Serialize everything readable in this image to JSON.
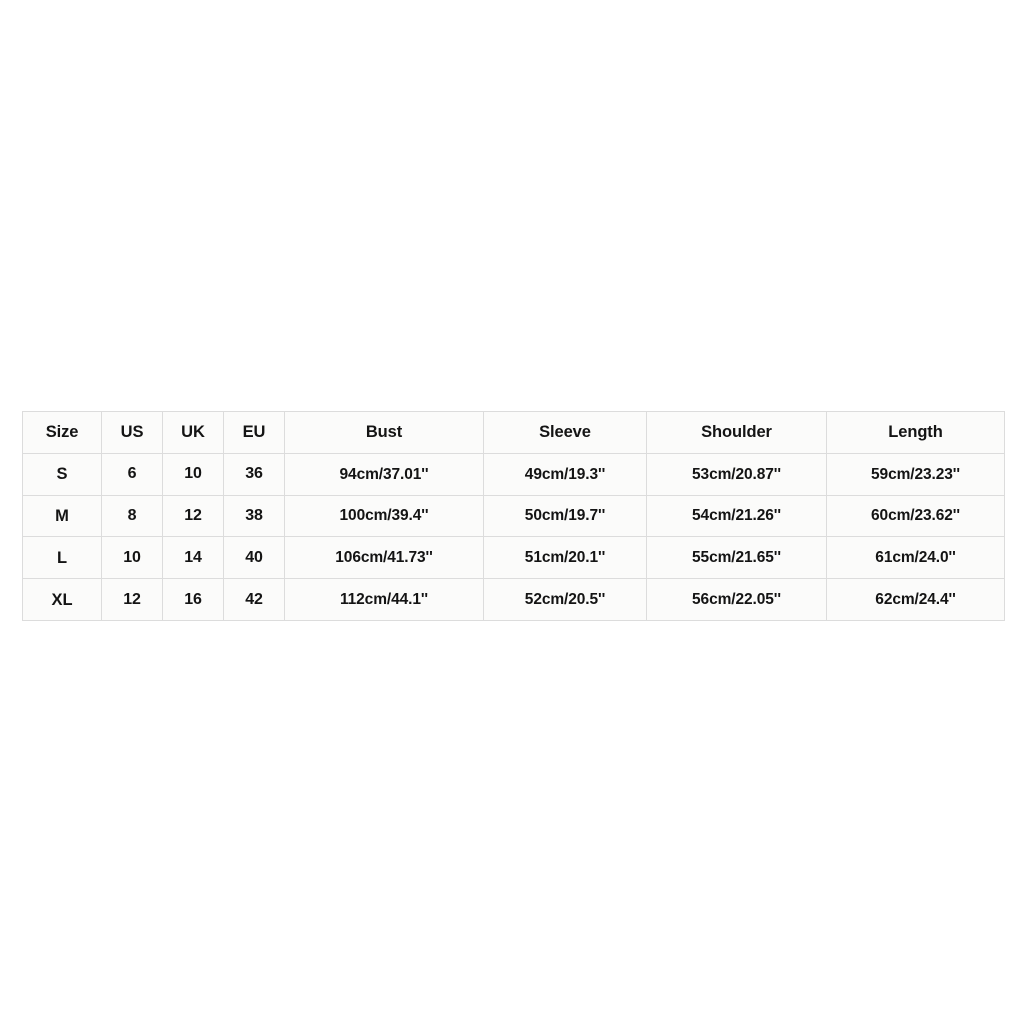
{
  "table": {
    "name": "clothing-size-chart",
    "columns": [
      {
        "key": "size",
        "label": "Size"
      },
      {
        "key": "us",
        "label": "US"
      },
      {
        "key": "uk",
        "label": "UK"
      },
      {
        "key": "eu",
        "label": "EU"
      },
      {
        "key": "bust",
        "label": "Bust"
      },
      {
        "key": "sleeve",
        "label": "Sleeve"
      },
      {
        "key": "shoulder",
        "label": "Shoulder"
      },
      {
        "key": "length",
        "label": "Length"
      }
    ],
    "rows": [
      {
        "size": "S",
        "us": "6",
        "uk": "10",
        "eu": "36",
        "bust": "94cm/37.01''",
        "sleeve": "49cm/19.3''",
        "shoulder": "53cm/20.87''",
        "length": "59cm/23.23''"
      },
      {
        "size": "M",
        "us": "8",
        "uk": "12",
        "eu": "38",
        "bust": "100cm/39.4''",
        "sleeve": "50cm/19.7''",
        "shoulder": "54cm/21.26''",
        "length": "60cm/23.62''"
      },
      {
        "size": "L",
        "us": "10",
        "uk": "14",
        "eu": "40",
        "bust": "106cm/41.73''",
        "sleeve": "51cm/20.1''",
        "shoulder": "55cm/21.65''",
        "length": "61cm/24.0''"
      },
      {
        "size": "XL",
        "us": "12",
        "uk": "16",
        "eu": "42",
        "bust": "112cm/44.1''",
        "sleeve": "52cm/20.5''",
        "shoulder": "56cm/22.05''",
        "length": "62cm/24.4''"
      }
    ]
  },
  "colors": {
    "page_background": "#ffffff",
    "cell_background": "#fbfbfa",
    "border": "#dcdcdc",
    "text": "#141414"
  }
}
